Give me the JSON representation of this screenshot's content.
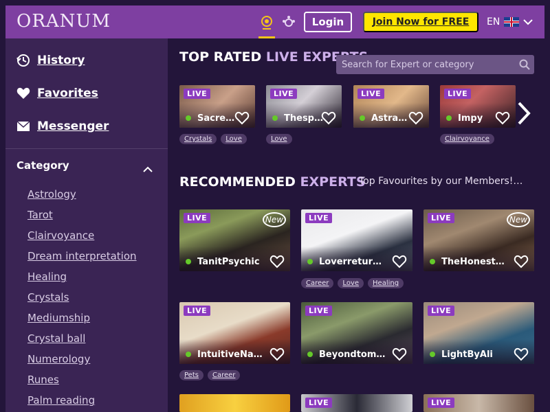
{
  "header": {
    "logo": "ORANUM",
    "login_label": "Login",
    "join_label": "Join Now for FREE",
    "language": "EN",
    "icons": [
      "psychic-icon",
      "community-icon",
      "chevron-down-icon"
    ]
  },
  "sidebar": {
    "links": [
      {
        "label": "History",
        "icon": "history-icon"
      },
      {
        "label": "Favorites",
        "icon": "heart-icon"
      },
      {
        "label": "Messenger",
        "icon": "envelope-icon"
      }
    ],
    "category_title": "Category",
    "categories": [
      "Astrology",
      "Tarot",
      "Clairvoyance",
      "Dream interpretation",
      "Healing",
      "Crystals",
      "Mediumship",
      "Crystal ball",
      "Numerology",
      "Runes",
      "Palm reading"
    ]
  },
  "top_rated": {
    "title_plain": "TOP RATED ",
    "title_accent": "LIVE EXPERTS",
    "search_placeholder": "Search for Expert or category",
    "cards": [
      {
        "name": "Sacre…",
        "live": "LIVE",
        "tags": [
          "Crystals",
          "Love"
        ]
      },
      {
        "name": "Thesp…",
        "live": "LIVE",
        "tags": [
          "Love"
        ]
      },
      {
        "name": "Astra…",
        "live": "LIVE",
        "tags": []
      },
      {
        "name": "Impy",
        "live": "LIVE",
        "tags": [
          "Clairvoyance"
        ]
      }
    ]
  },
  "recommended": {
    "title_plain": "RECOMMENDED ",
    "title_accent": "EXPERTS",
    "subtitle": "Top Favourites by our Members!…",
    "new_badge": "New",
    "cards": [
      {
        "name": "TanitPsychic",
        "live": "LIVE",
        "is_new": true,
        "tags": []
      },
      {
        "name": "Loverreturner",
        "live": "LIVE",
        "is_new": false,
        "tags": [
          "Career",
          "Love",
          "Healing"
        ]
      },
      {
        "name": "TheHonestRe…",
        "live": "LIVE",
        "is_new": true,
        "tags": []
      },
      {
        "name": "IntuitiveNata…",
        "live": "LIVE",
        "is_new": false,
        "tags": [
          "Pets",
          "Career"
        ]
      },
      {
        "name": "Beyondtomor…",
        "live": "LIVE",
        "is_new": false,
        "tags": []
      },
      {
        "name": "LightByAli",
        "live": "LIVE",
        "is_new": false,
        "tags": []
      },
      {
        "name": "",
        "live": "",
        "is_new": false,
        "tags": []
      },
      {
        "name": "",
        "live": "LIVE",
        "is_new": false,
        "tags": []
      },
      {
        "name": "",
        "live": "LIVE",
        "is_new": false,
        "tags": []
      }
    ]
  },
  "colors": {
    "page_bg": "#23153a",
    "header_bg": "#7e3fa1",
    "sidebar_bg": "#3a2454",
    "join_button": "#ffe600",
    "live_badge": "#8c3bbf",
    "accent_text": "#cdb0ea"
  }
}
